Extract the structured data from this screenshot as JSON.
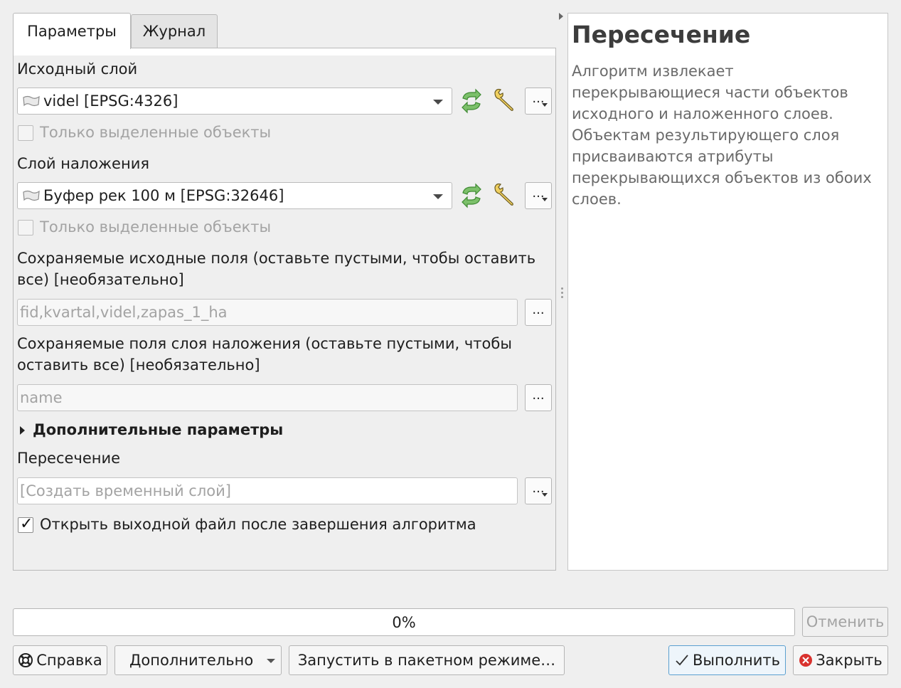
{
  "tabs": [
    {
      "label": "Параметры",
      "active": true
    },
    {
      "label": "Журнал",
      "active": false
    }
  ],
  "params": {
    "input_layer": {
      "label": "Исходный слой",
      "value": "videl [EPSG:4326]",
      "selected_only": "Только выделенные объекты"
    },
    "overlay_layer": {
      "label": "Слой наложения",
      "value": "Буфер рек 100 м [EPSG:32646]",
      "selected_only": "Только выделенные объекты"
    },
    "input_fields": {
      "label_line1": "Сохраняемые исходные поля (оставьте пустыми, чтобы оставить",
      "label_line2": "все) [необязательно]",
      "value": "fid,kvartal,videl,zapas_1_ha"
    },
    "overlay_fields": {
      "label_line1": "Сохраняемые поля слоя наложения (оставьте пустыми, чтобы",
      "label_line2": "оставить все) [необязательно]",
      "value": "name"
    },
    "advanced": {
      "label": "Дополнительные параметры"
    },
    "output": {
      "label": "Пересечение",
      "placeholder": "[Создать временный слой]"
    },
    "open_output": {
      "label": "Открыть выходной файл после завершения алгоритма",
      "checked": true
    },
    "dots": "..."
  },
  "help": {
    "title": "Пересечение",
    "text": "Алгоритм извлекает перекрывающиеся части объектов исходного и наложенного слоев. Объектам результирующего слоя присваиваются атрибуты перекрывающихся объектов из обоих слоев."
  },
  "progress": {
    "value": 0,
    "label": "0%"
  },
  "buttons": {
    "cancel": "Отменить",
    "help": "Справка",
    "advanced": "Дополнительно",
    "batch": "Запустить в пакетном режиме…",
    "run": "Выполнить",
    "close": "Закрыть"
  },
  "colors": {
    "accent_border": "#5aa0d0",
    "refresh_green": "#5fa84a",
    "close_red": "#d9322e"
  }
}
